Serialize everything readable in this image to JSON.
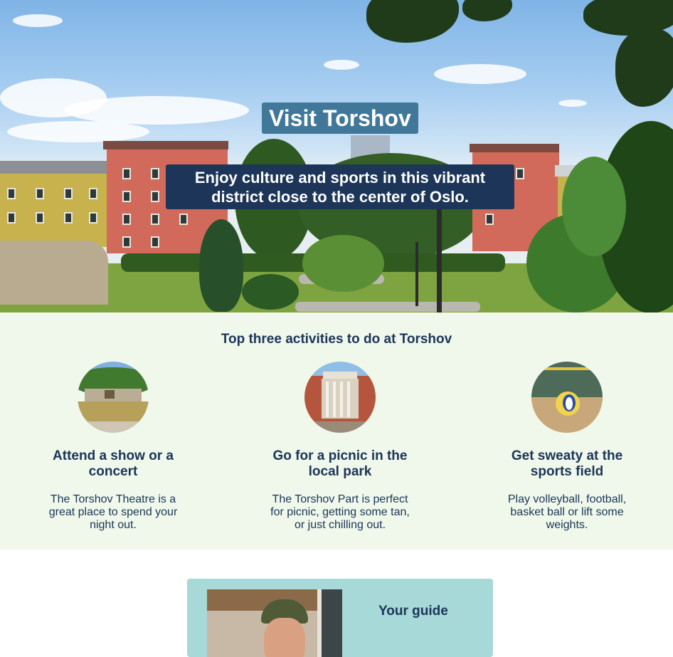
{
  "hero": {
    "title": "Visit Torshov",
    "subtitle_line1": "Enjoy culture and sports in this vibrant",
    "subtitle_line2": "district close to the center of Oslo."
  },
  "activities": {
    "heading": "Top three activities to do at Torshov",
    "items": [
      {
        "title_line1": "Attend a show or a",
        "title_line2": "concert",
        "desc_line1": "The Torshov Theatre is a",
        "desc_line2": "great place to spend your",
        "desc_line3": "night out.",
        "image": "park-pond-photo"
      },
      {
        "title_line1": "Go for a picnic in the",
        "title_line2": "local park",
        "desc_line1": "The Torshov Part is perfect",
        "desc_line2": "for picnic, getting some tan,",
        "desc_line3": "or just chilling out.",
        "image": "theatre-building-photo"
      },
      {
        "title_line1": "Get sweaty at the",
        "title_line2": "sports field",
        "desc_line1": "Play volleyball, football,",
        "desc_line2": "basket ball or lift some",
        "desc_line3": "weights.",
        "image": "volleyball-photo"
      }
    ]
  },
  "guide": {
    "title": "Your guide",
    "image": "guide-portrait-photo"
  },
  "colors": {
    "navy": "#1c3558",
    "title_bg": "#41789a",
    "section_bg": "#eff8eb",
    "guide_bg": "#a6d9d8"
  }
}
